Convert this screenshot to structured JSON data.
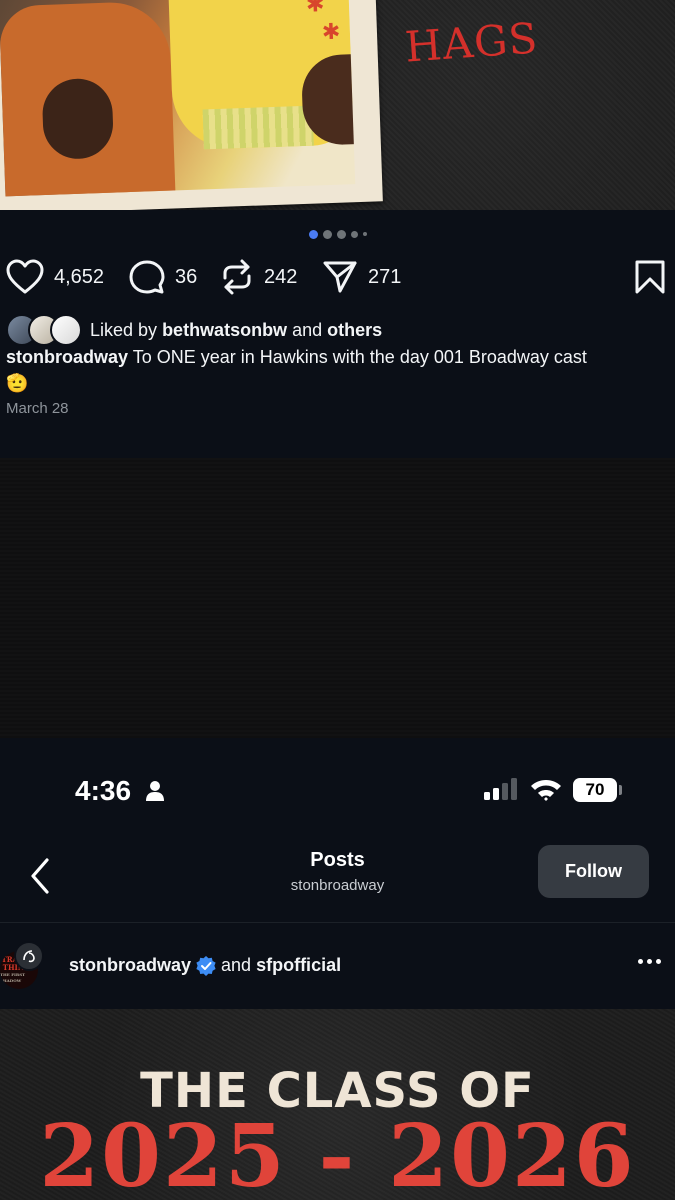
{
  "top_image": {
    "handwritten_text": "HAGS"
  },
  "carousel": {
    "total_dots": 5,
    "active_index": 0
  },
  "actions": {
    "likes": "4,652",
    "comments": "36",
    "reposts": "242",
    "shares": "271"
  },
  "liked_by": {
    "prefix": "Liked by",
    "user": "bethwatsonbw",
    "middle": "and",
    "others": "others"
  },
  "caption": {
    "username": "stonbroadway",
    "text": "To ONE year in Hawkins with the day 001 Broadway cast",
    "emoji": "🫡"
  },
  "date": "March 28",
  "status_bar": {
    "time": "4:36",
    "battery": "70"
  },
  "nav": {
    "title": "Posts",
    "subtitle": "stonbroadway",
    "follow_label": "Follow"
  },
  "post_header": {
    "username": "stonbroadway",
    "joiner": "and",
    "collaborator": "sfpofficial"
  },
  "poster": {
    "line1": "THE CLASS OF",
    "line2": "2025 - 2026"
  },
  "colors": {
    "background": "#0b0f17",
    "accent_blue": "#4b7cf3",
    "poster_red": "#e0443a",
    "follow_button": "#363b42"
  }
}
